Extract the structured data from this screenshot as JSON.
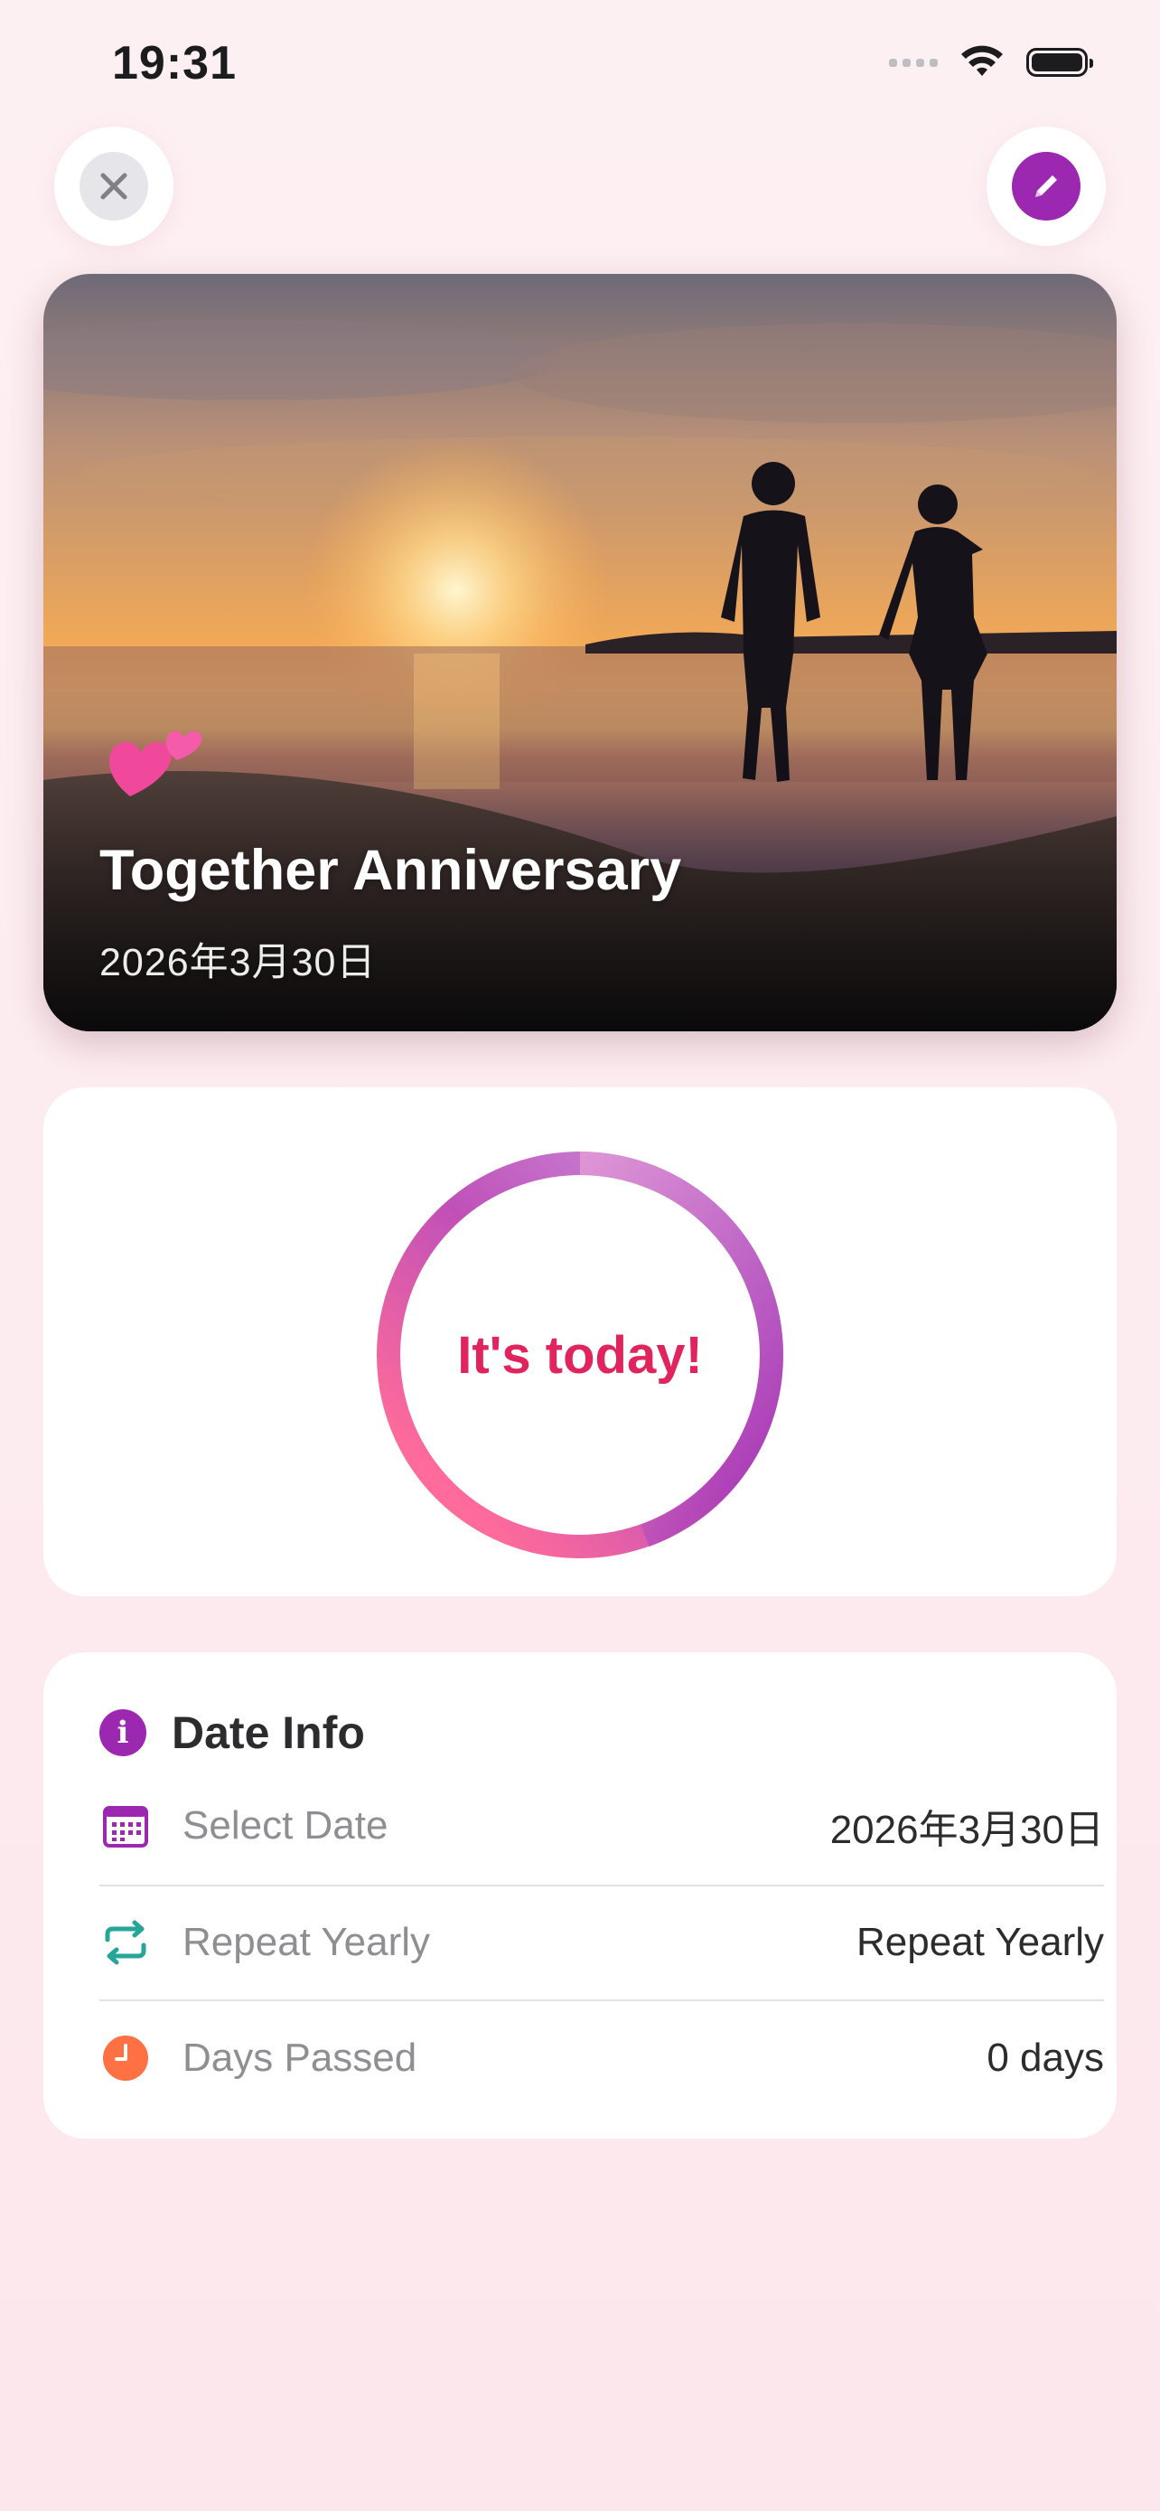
{
  "status_bar": {
    "time": "19:31"
  },
  "hero": {
    "title": "Together Anniversary",
    "date": "2026年3月30日",
    "emoji": "💕"
  },
  "countdown": {
    "text": "It's today!",
    "progress": 1.0
  },
  "info": {
    "title": "Date Info",
    "rows": [
      {
        "label": "Select Date",
        "value": "2026年3月30日",
        "icon": "calendar-icon"
      },
      {
        "label": "Repeat Yearly",
        "value": "Repeat Yearly",
        "icon": "repeat-icon"
      },
      {
        "label": "Days Passed",
        "value": "0 days",
        "icon": "clock-icon"
      }
    ]
  },
  "colors": {
    "accent": "#9C27B0",
    "highlight": "#E0245E",
    "repeat": "#26A69A",
    "clock": "#FF7043",
    "background": "#FCE7EC"
  }
}
